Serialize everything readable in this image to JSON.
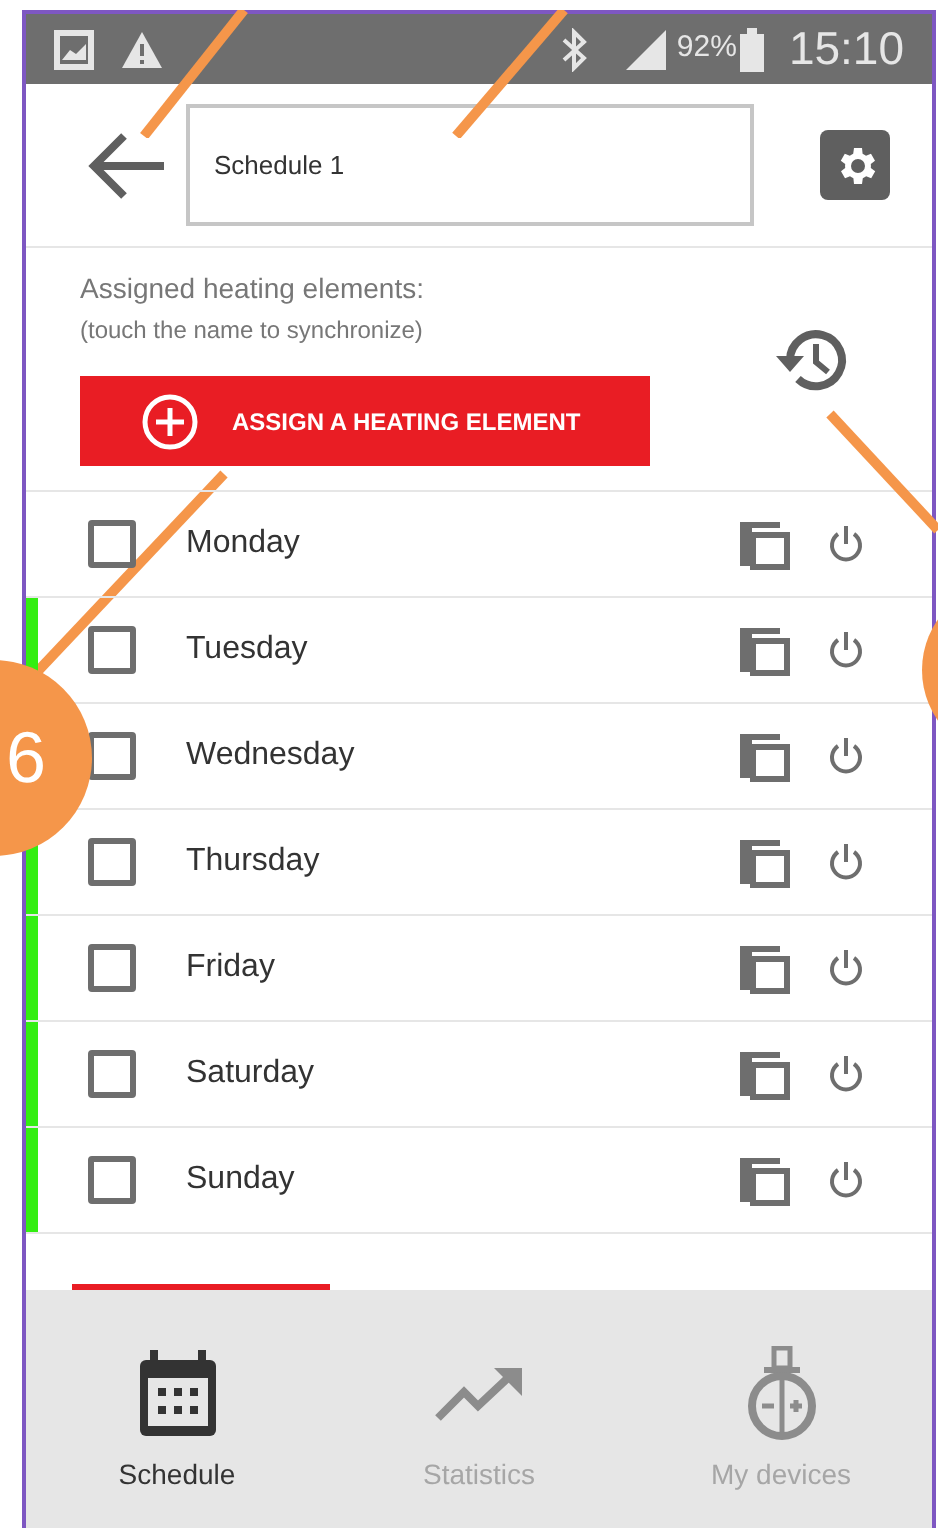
{
  "status_bar": {
    "battery": "92%",
    "time": "15:10"
  },
  "header": {
    "name_field": {
      "value": "Schedule 1"
    }
  },
  "assigned": {
    "title": "Assigned heating elements:",
    "hint": "(touch the name to synchronize)",
    "button": "ASSIGN A HEATING ELEMENT"
  },
  "days": [
    {
      "label": "Monday",
      "checked": false,
      "active": false
    },
    {
      "label": "Tuesday",
      "checked": false,
      "active": true
    },
    {
      "label": "Wednesday",
      "checked": false,
      "active": true
    },
    {
      "label": "Thursday",
      "checked": false,
      "active": true
    },
    {
      "label": "Friday",
      "checked": false,
      "active": true
    },
    {
      "label": "Saturday",
      "checked": false,
      "active": true
    },
    {
      "label": "Sunday",
      "checked": false,
      "active": true
    }
  ],
  "bottom_nav": [
    {
      "label": "Schedule",
      "kind": "calendar",
      "selected": true
    },
    {
      "label": "Statistics",
      "kind": "trend",
      "selected": false
    },
    {
      "label": "My devices",
      "kind": "device",
      "selected": false
    }
  ],
  "callouts": [
    {
      "label": "6"
    }
  ]
}
